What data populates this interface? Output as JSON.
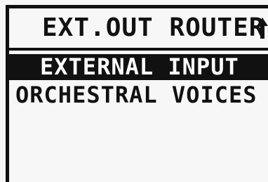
{
  "screen": {
    "title": "EXT.OUT ROUTER",
    "scroll_indicator_icon": "scroll-arrow-icon"
  },
  "menu": {
    "items": [
      {
        "label": "EXTERNAL INPUT",
        "selected": true
      },
      {
        "label": "ORCHESTRAL VOICES",
        "selected": false
      }
    ]
  },
  "colors": {
    "foreground": "#111111",
    "background": "#f7f7f7",
    "highlight_text": "#ffffff"
  }
}
